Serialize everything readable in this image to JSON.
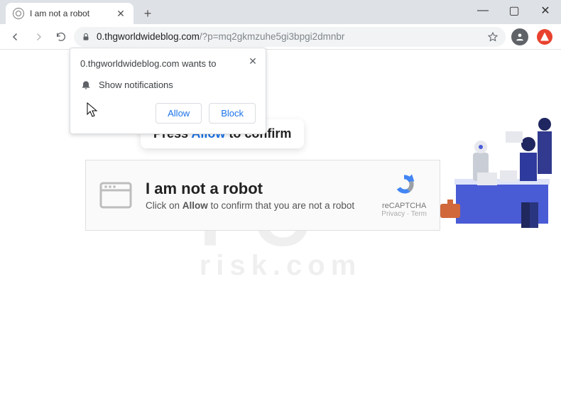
{
  "window": {
    "tab_title": "I am not a robot",
    "min": "—",
    "max": "▢",
    "close": "✕"
  },
  "toolbar": {
    "url_domain": "0.thgworldwideblog.com",
    "url_path": "/?p=mq2gkmzuhe5gi3bpgi2dmnbr"
  },
  "permission_popup": {
    "origin_line": "0.thgworldwideblog.com wants to",
    "capability": "Show notifications",
    "allow": "Allow",
    "block": "Block"
  },
  "press_bubble": {
    "pre": "Press ",
    "highlight": "Allow",
    "post": " to confirm"
  },
  "captcha_card": {
    "title": "I am not a robot",
    "subtitle_pre": "Click on ",
    "subtitle_bold": "Allow",
    "subtitle_post": " to confirm that you are not a robot",
    "recaptcha_label": "reCAPTCHA",
    "recaptcha_sub": "Privacy · Term"
  },
  "watermark": {
    "line1": "PC",
    "line2": "risk.com"
  }
}
